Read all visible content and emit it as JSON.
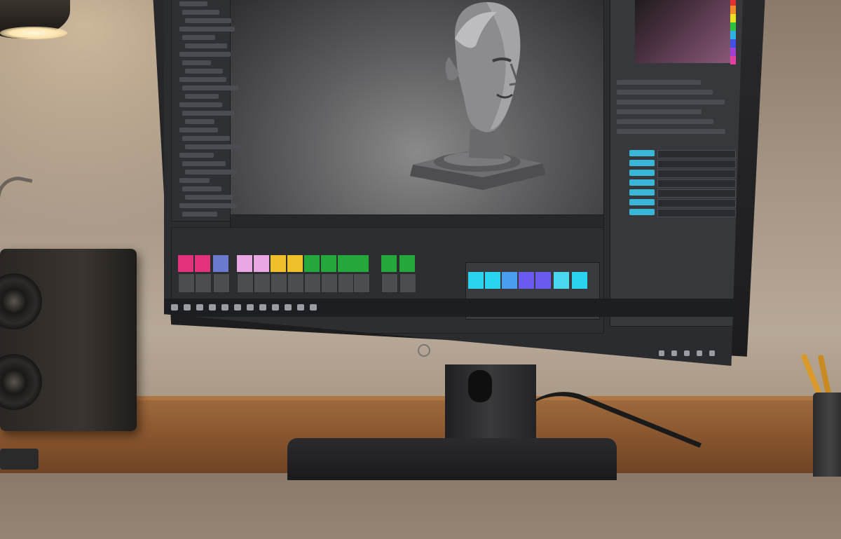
{
  "scene": {
    "description_colors": {
      "wall": "#a39383",
      "desk": "#8e5a31",
      "monitor_frame": "#1b1b1d",
      "app_background": "#2b2c30"
    }
  },
  "app": {
    "window_type": "3d-sculpting-application",
    "timeline_clip_colors": [
      "#e2327c",
      "#e2327c",
      "#6a7ad0",
      "#e9a8e3",
      "#e9a8e3",
      "#f0c02a",
      "#f0c02a",
      "#25a83b",
      "#25a83b",
      "#25a83b",
      "#25a83b",
      "#25a83b",
      "#25a83b",
      "#2ad3f0",
      "#2ad3f0",
      "#4a9ef0",
      "#6a5af0",
      "#6a5af0",
      "#4ad8f0",
      "#2ad3f0"
    ],
    "hue_swatches": [
      "#e03030",
      "#f08a2a",
      "#e8e020",
      "#30c040",
      "#30b0e0",
      "#4050e0",
      "#a040d0",
      "#e040a0"
    ],
    "icons": [
      "lamp-icon",
      "monitor-logo-icon",
      "windows-start-icon",
      "search-icon",
      "file-explorer-icon",
      "browser-icon",
      "app-icon"
    ]
  }
}
